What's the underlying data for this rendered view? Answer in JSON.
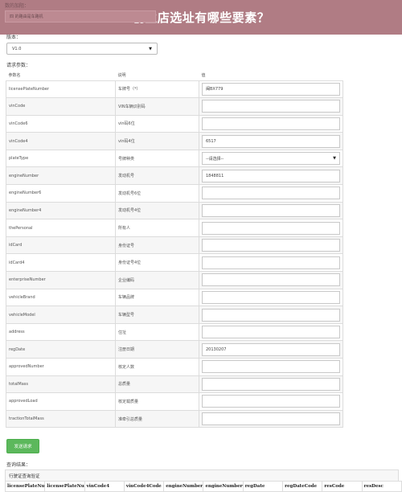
{
  "banner": {
    "title": "创业店选址有哪些要素？",
    "ghost_label": "数的加阻：",
    "ghost_field": "四 的路由是车路机"
  },
  "version": {
    "label": "版本：",
    "value": "V1.0"
  },
  "params": {
    "label": "请求参数：",
    "headers": {
      "name": "参数名",
      "desc": "说明",
      "value": "值"
    },
    "rows": [
      {
        "name": "licensePlateNumber",
        "desc": "车牌号（*）",
        "value": "闽BX779"
      },
      {
        "name": "vinCode",
        "desc": "VIN车辆识别码",
        "value": ""
      },
      {
        "name": "vinCode6",
        "desc": "vin码6位",
        "value": ""
      },
      {
        "name": "vinCode4",
        "desc": "vin码4位",
        "value": "6517"
      },
      {
        "name": "plateType",
        "desc": "号牌种类",
        "value": "--请选择--",
        "type": "select"
      },
      {
        "name": "engineNumber",
        "desc": "发动机号",
        "value": "1848811"
      },
      {
        "name": "engineNumber6",
        "desc": "发动机号6位",
        "value": ""
      },
      {
        "name": "engineNumber4",
        "desc": "发动机号4位",
        "value": ""
      },
      {
        "name": "thePersonal",
        "desc": "所有人",
        "value": ""
      },
      {
        "name": "idCard",
        "desc": "身份证号",
        "value": ""
      },
      {
        "name": "idCard4",
        "desc": "身份证号4位",
        "value": ""
      },
      {
        "name": "enterpriseNumber",
        "desc": "企业编码",
        "value": ""
      },
      {
        "name": "vehicleBrand",
        "desc": "车辆品牌",
        "value": ""
      },
      {
        "name": "vehicleModel",
        "desc": "车辆型号",
        "value": ""
      },
      {
        "name": "address",
        "desc": "住址",
        "value": ""
      },
      {
        "name": "regDate",
        "desc": "注册日期",
        "value": "20130207"
      },
      {
        "name": "approvedNumber",
        "desc": "核定人数",
        "value": ""
      },
      {
        "name": "totalMass",
        "desc": "总质量",
        "value": ""
      },
      {
        "name": "approvedLoad",
        "desc": "核定载质量",
        "value": ""
      },
      {
        "name": "tractionTotalMass",
        "desc": "准牵引总质量",
        "value": ""
      }
    ]
  },
  "send_button": "发送请求",
  "result": {
    "label": "查询结果：",
    "box_title": "行驶证查询验证",
    "columns": [
      "licensePlateNumber",
      "licensePlateNumberCode",
      "vinCode4",
      "vinCode4Code",
      "engineNumber",
      "engineNumberCode",
      "regDate",
      "regDateCode",
      "resCode",
      "resDesc"
    ]
  }
}
